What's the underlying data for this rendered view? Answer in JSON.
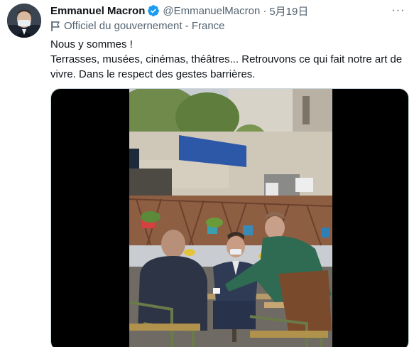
{
  "tweet": {
    "author": {
      "name": "Emmanuel Macron",
      "handle": "@EmmanuelMacron",
      "verified": true,
      "avatar_icon": "avatar"
    },
    "separator": "·",
    "date": "5月19日",
    "label": {
      "icon": "flag-icon",
      "text": "Officiel du gouvernement - France"
    },
    "text": {
      "line1": "Nous y sommes !",
      "line2": "Terrasses, musées, cinémas, théâtres... Retrouvons ce qui fait notre art de vivre. Dans le respect des gestes barrières."
    },
    "media": {
      "type": "video"
    }
  },
  "colors": {
    "primary_text": "#0f1419",
    "secondary_text": "#536471",
    "verified_blue": "#1d9bf0",
    "media_background": "#000000"
  }
}
